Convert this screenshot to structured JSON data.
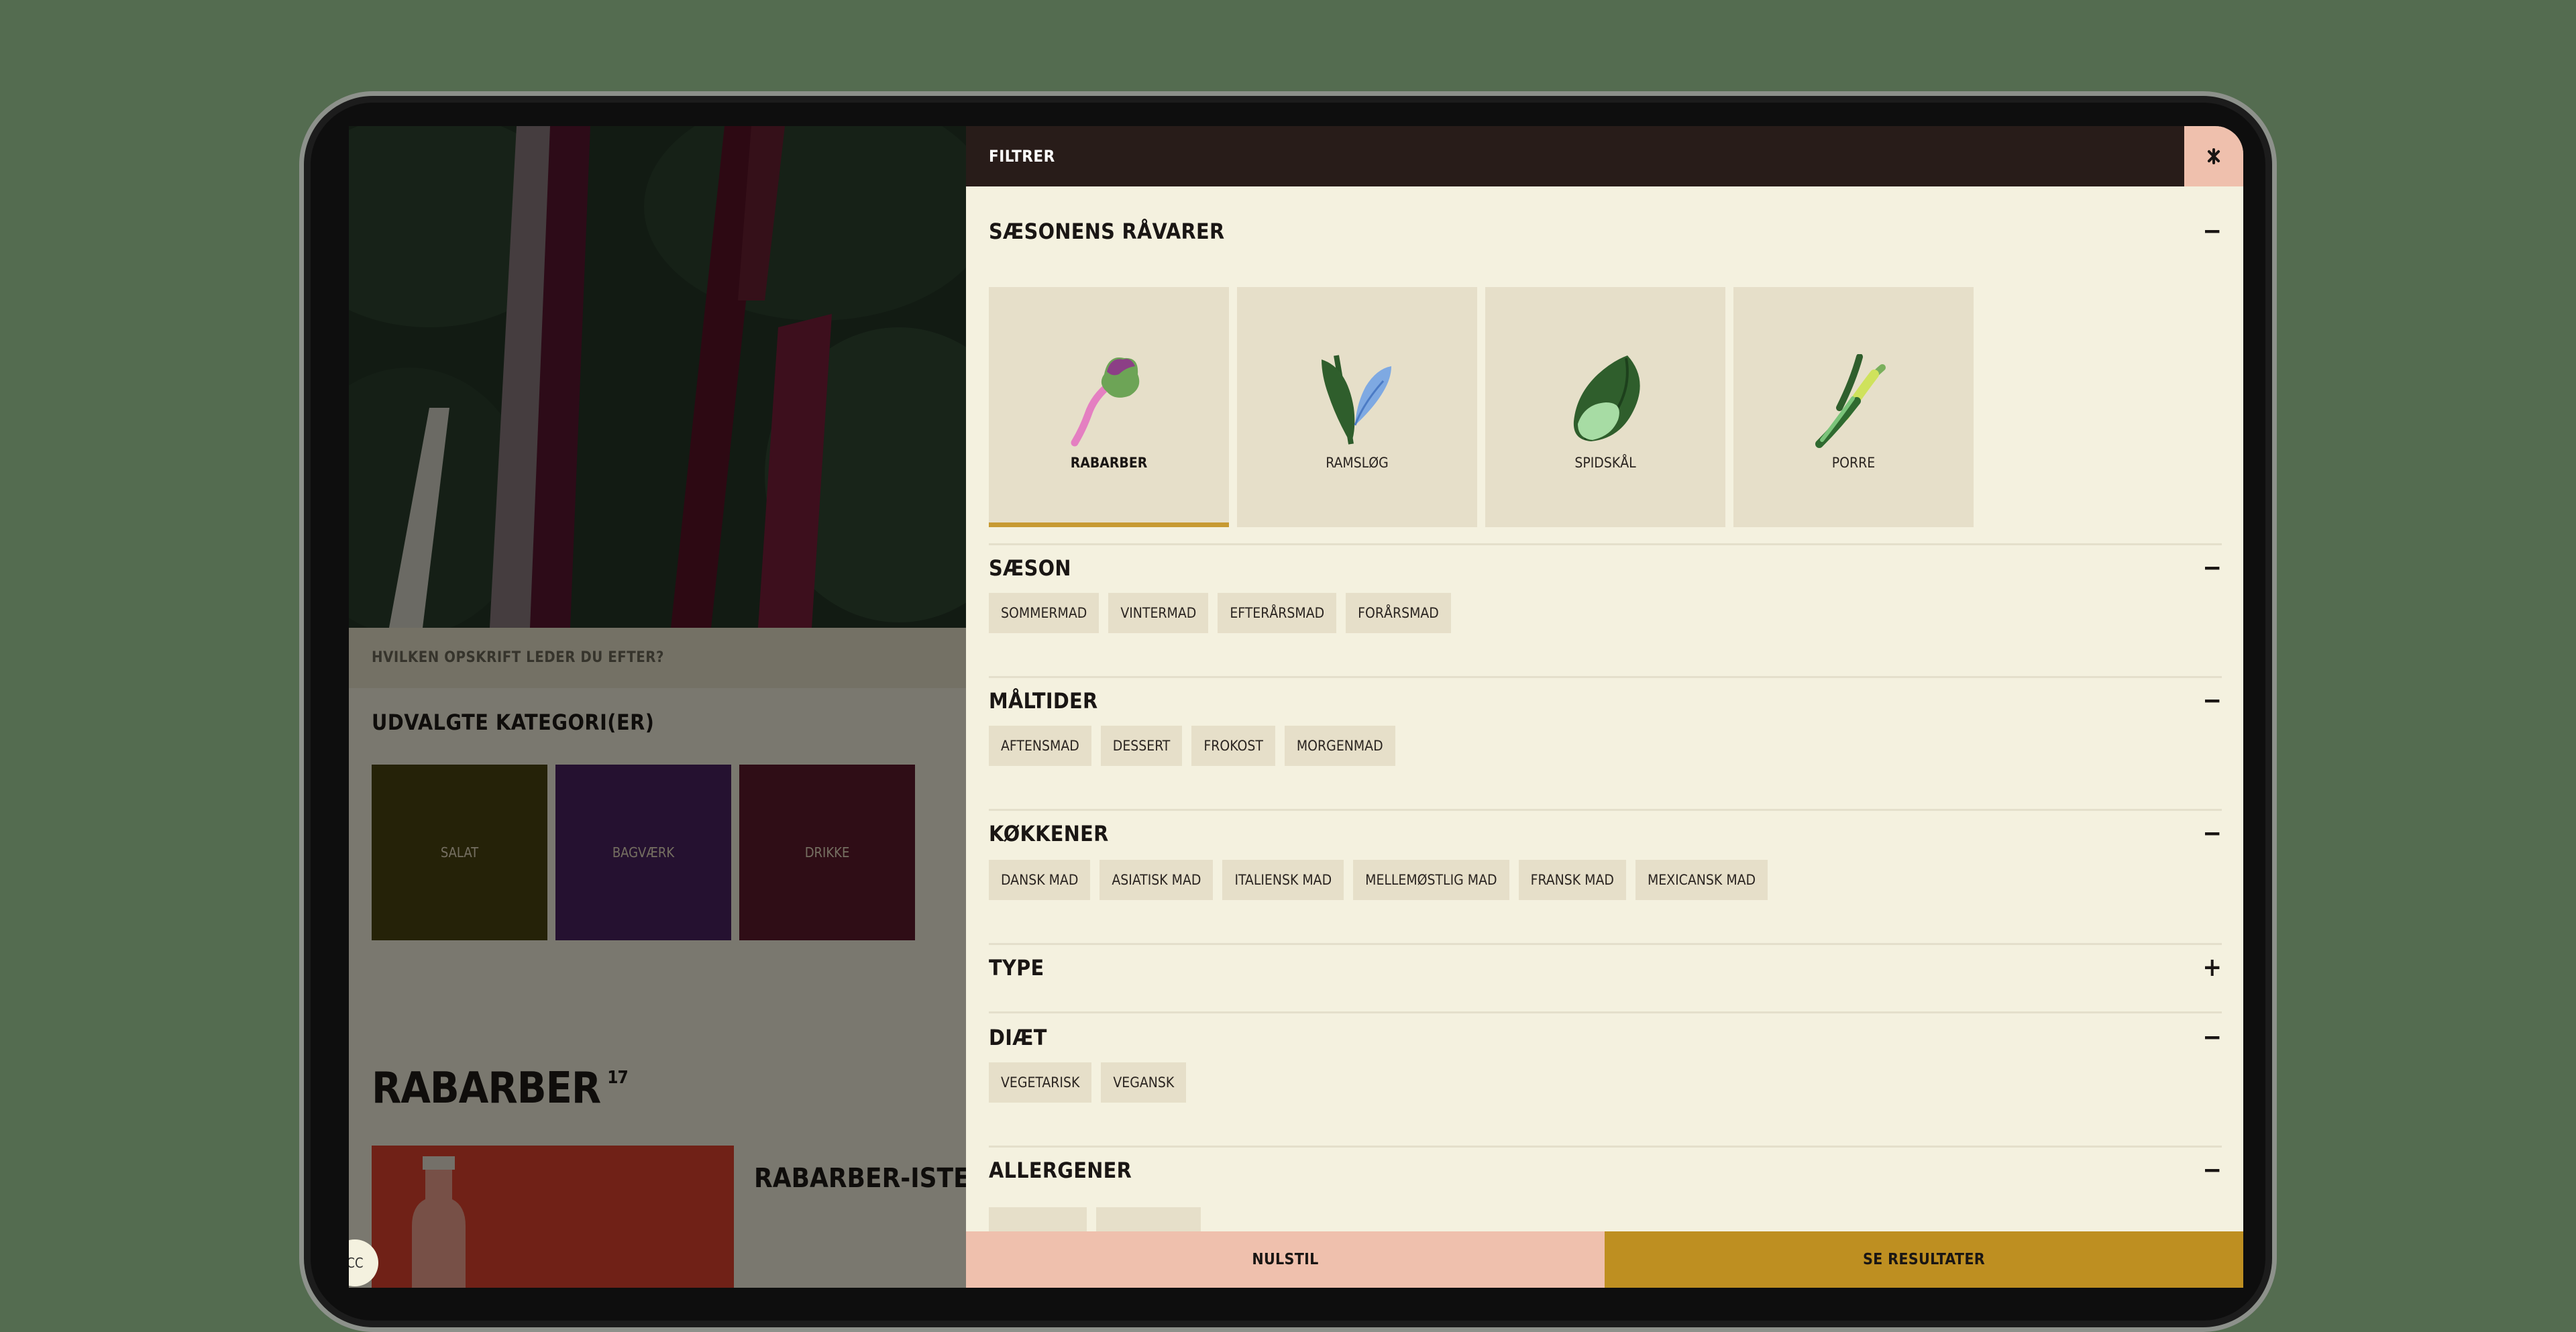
{
  "left_page": {
    "search_prompt": "HVILKEN OPSKRIFT LEDER DU EFTER?",
    "categories_title": "UDVALGTE KATEGORI(ER)",
    "categories": [
      {
        "label": "SALAT",
        "color": "#4a4410"
      },
      {
        "label": "BAGVÆRK",
        "color": "#4b2360"
      },
      {
        "label": "DRIKKE",
        "color": "#5e1b2c"
      }
    ],
    "results_title": "RABARBER",
    "results_count": "17",
    "recipe_title": "RABARBER-ISTE",
    "cc_label": "CC"
  },
  "filter": {
    "title": "FILTRER",
    "close_icon": "close-x-icon",
    "sections": {
      "seasonal": {
        "title": "SÆSONENS RÅVARER",
        "toggle": "−",
        "items": [
          {
            "label": "RABARBER",
            "icon": "rhubarb-icon",
            "selected": true
          },
          {
            "label": "RAMSLØG",
            "icon": "wild-garlic-icon",
            "selected": false
          },
          {
            "label": "SPIDSKÅL",
            "icon": "pointed-cabbage-icon",
            "selected": false
          },
          {
            "label": "PORRE",
            "icon": "leek-icon",
            "selected": false
          }
        ]
      },
      "season": {
        "title": "SÆSON",
        "toggle": "−",
        "chips": [
          "SOMMERMAD",
          "VINTERMAD",
          "EFTERÅRSMAD",
          "FORÅRSMAD"
        ]
      },
      "meals": {
        "title": "MÅLTIDER",
        "toggle": "−",
        "chips": [
          "AFTENSMAD",
          "DESSERT",
          "FROKOST",
          "MORGENMAD"
        ]
      },
      "kitchens": {
        "title": "KØKKENER",
        "toggle": "−",
        "chips": [
          "DANSK MAD",
          "ASIATISK MAD",
          "ITALIENSK MAD",
          "MELLEMØSTLIG MAD",
          "FRANSK MAD",
          "MEXICANSK MAD"
        ]
      },
      "type": {
        "title": "TYPE",
        "toggle": "+"
      },
      "diet": {
        "title": "DIÆT",
        "toggle": "−",
        "chips": [
          "VEGETARISK",
          "VEGANSK"
        ]
      },
      "allergens": {
        "title": "ALLERGENER",
        "toggle": "−"
      }
    },
    "reset_label": "NULSTIL",
    "results_label": "SE RESULTATER"
  },
  "colors": {
    "panel_bg": "#f4f1df",
    "header_bg": "#281c19",
    "chip_bg": "#e6dfc9",
    "accent_gold": "#be8f21",
    "accent_pink": "#efc0ad",
    "page_bg": "#546c50"
  }
}
